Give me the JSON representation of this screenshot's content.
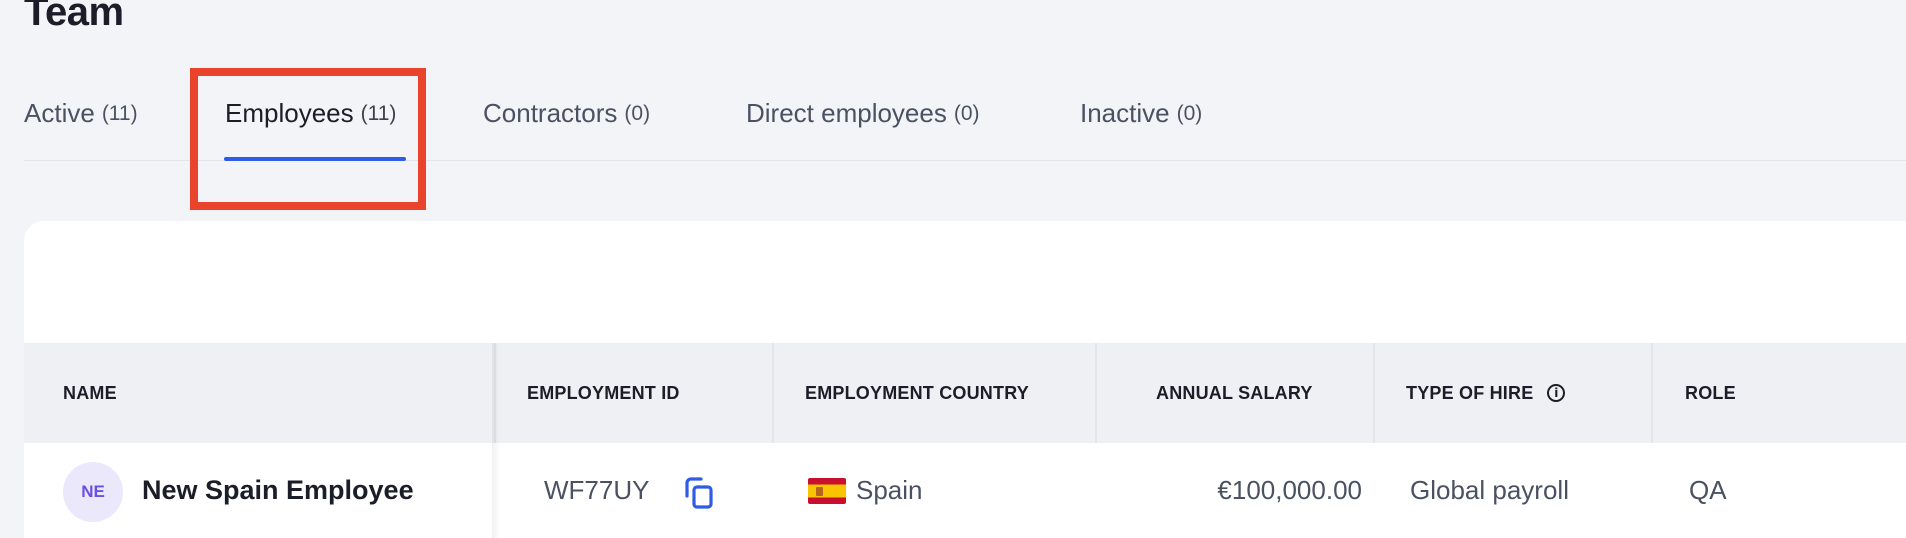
{
  "page": {
    "title": "Team"
  },
  "tabs": [
    {
      "label": "Active",
      "count": "(11)"
    },
    {
      "label": "Employees",
      "count": "(11)"
    },
    {
      "label": "Contractors",
      "count": "(0)"
    },
    {
      "label": "Direct employees",
      "count": "(0)"
    },
    {
      "label": "Inactive",
      "count": "(0)"
    }
  ],
  "active_tab": "Employees",
  "table": {
    "columns": [
      "NAME",
      "EMPLOYMENT ID",
      "EMPLOYMENT COUNTRY",
      "ANNUAL SALARY",
      "TYPE OF HIRE",
      "ROLE"
    ],
    "rows": [
      {
        "avatar_initials": "NE",
        "name": "New Spain Employee",
        "employment_id": "WF77UY",
        "country": "Spain",
        "annual_salary": "€100,000.00",
        "type_of_hire": "Global payroll",
        "role": "QA"
      }
    ]
  },
  "icons": {
    "copy": "copy-icon",
    "info": "info-icon",
    "flag": "spain-flag-icon"
  },
  "colors": {
    "accent": "#2e5ce6",
    "highlight": "#e9432b",
    "avatar_bg": "#ece8fb",
    "avatar_text": "#6b4fe0"
  }
}
